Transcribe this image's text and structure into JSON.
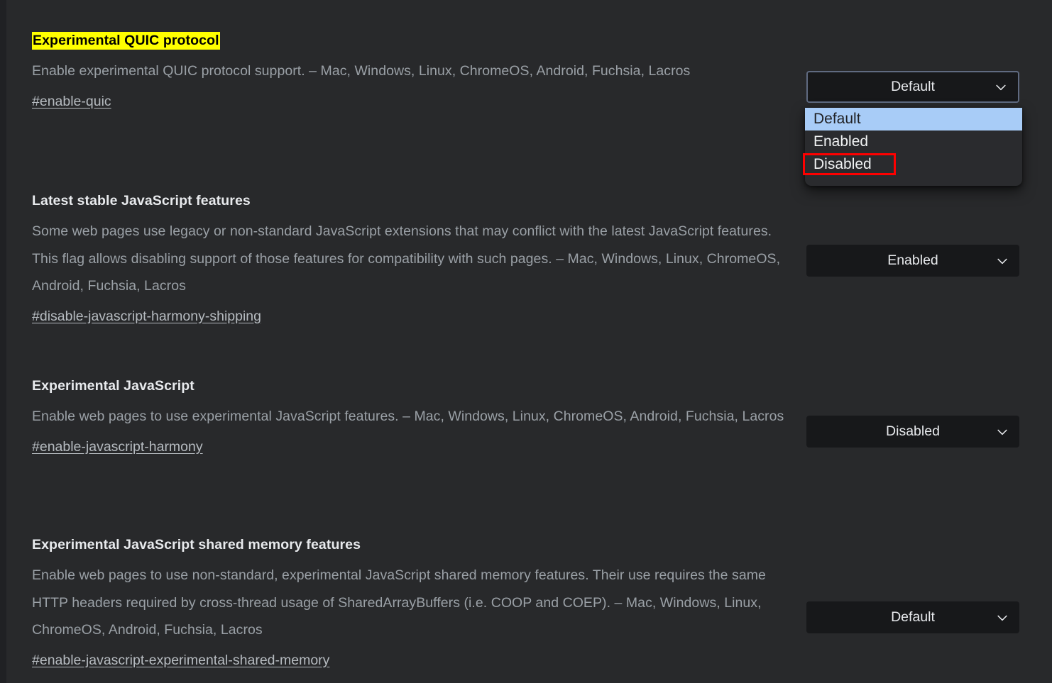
{
  "theme": {
    "page_bg": "#28292b",
    "gutter": "#202124",
    "title_color": "#e8eaed",
    "desc_color": "#9aa0a6",
    "link_color": "#b6bbc0",
    "select_bg": "#17181a",
    "highlight_bg": "#ffff00",
    "highlight_fg": "#000000",
    "dropdown_bg": "#2a2b2e",
    "option_selected_bg": "#a8ccf7",
    "annotation_color": "#fe0000",
    "focus_ring": "#5f6a80"
  },
  "flags": [
    {
      "title": "Experimental QUIC protocol",
      "title_highlighted": true,
      "description": "Enable experimental QUIC protocol support. – Mac, Windows, Linux, ChromeOS, Android, Fuchsia, Lacros",
      "link": "#enable-quic",
      "select": {
        "value": "Default",
        "focused": true,
        "expanded": true,
        "options": [
          "Default",
          "Enabled",
          "Disabled"
        ],
        "highlighted_option": "Default",
        "annotated_option": "Disabled"
      }
    },
    {
      "title": "Latest stable JavaScript features",
      "title_highlighted": false,
      "description": "Some web pages use legacy or non-standard JavaScript extensions that may conflict with the latest JavaScript features. This flag allows disabling support of those features for compatibility with such pages. – Mac, Windows, Linux, ChromeOS, Android, Fuchsia, Lacros",
      "link": "#disable-javascript-harmony-shipping",
      "select": {
        "value": "Enabled",
        "focused": false,
        "expanded": false,
        "options": [
          "Default",
          "Enabled",
          "Disabled"
        ]
      }
    },
    {
      "title": "Experimental JavaScript",
      "title_highlighted": false,
      "description": "Enable web pages to use experimental JavaScript features. – Mac, Windows, Linux, ChromeOS, Android, Fuchsia, Lacros",
      "link": "#enable-javascript-harmony",
      "select": {
        "value": "Disabled",
        "focused": false,
        "expanded": false,
        "options": [
          "Default",
          "Enabled",
          "Disabled"
        ]
      }
    },
    {
      "title": "Experimental JavaScript shared memory features",
      "title_highlighted": false,
      "description": "Enable web pages to use non-standard, experimental JavaScript shared memory features. Their use requires the same HTTP headers required by cross-thread usage of SharedArrayBuffers (i.e. COOP and COEP). – Mac, Windows, Linux, ChromeOS, Android, Fuchsia, Lacros",
      "link": "#enable-javascript-experimental-shared-memory",
      "select": {
        "value": "Default",
        "focused": false,
        "expanded": false,
        "options": [
          "Default",
          "Enabled",
          "Disabled"
        ]
      }
    }
  ],
  "icons": {
    "chevron_down": "chevron-down-icon"
  }
}
